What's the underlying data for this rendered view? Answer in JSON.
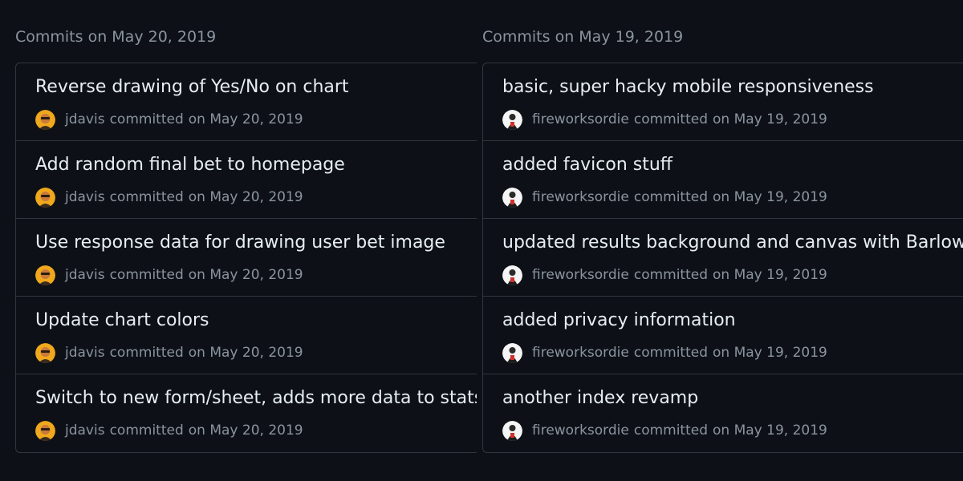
{
  "groups": [
    {
      "title": "Commits on May 20, 2019",
      "commits": [
        {
          "title": "Reverse drawing of Yes/No on chart",
          "author": "jdavis",
          "verb": "committed",
          "date": "on May 20, 2019"
        },
        {
          "title": "Add random final bet to homepage",
          "author": "jdavis",
          "verb": "committed",
          "date": "on May 20, 2019"
        },
        {
          "title": "Use response data for drawing user bet image",
          "author": "jdavis",
          "verb": "committed",
          "date": "on May 20, 2019"
        },
        {
          "title": "Update chart colors",
          "author": "jdavis",
          "verb": "committed",
          "date": "on May 20, 2019"
        },
        {
          "title": "Switch to new form/sheet, adds more data to stats",
          "author": "jdavis",
          "verb": "committed",
          "date": "on May 20, 2019"
        }
      ]
    },
    {
      "title": "Commits on May 19, 2019",
      "commits": [
        {
          "title": "basic, super hacky mobile responsiveness",
          "author": "fireworksordie",
          "verb": "committed",
          "date": "on May 19, 2019"
        },
        {
          "title": "added favicon stuff",
          "author": "fireworksordie",
          "verb": "committed",
          "date": "on May 19, 2019"
        },
        {
          "title": "updated results background and canvas with Barlow",
          "author": "fireworksordie",
          "verb": "committed",
          "date": "on May 19, 2019"
        },
        {
          "title": "added privacy information",
          "author": "fireworksordie",
          "verb": "committed",
          "date": "on May 19, 2019"
        },
        {
          "title": "another index revamp",
          "author": "fireworksordie",
          "verb": "committed",
          "date": "on May 19, 2019"
        }
      ]
    }
  ],
  "colors": {
    "background": "#0d1117",
    "border": "#30363d",
    "title_text": "#e6edf3",
    "muted_text": "#8b949e",
    "jdavis_avatar": "#f0a81c",
    "fireworksordie_avatar": "#f5f5f5"
  },
  "icons": {
    "jdavis_avatar": "avatar-jdavis-icon",
    "fireworksordie_avatar": "avatar-fireworksordie-icon"
  }
}
